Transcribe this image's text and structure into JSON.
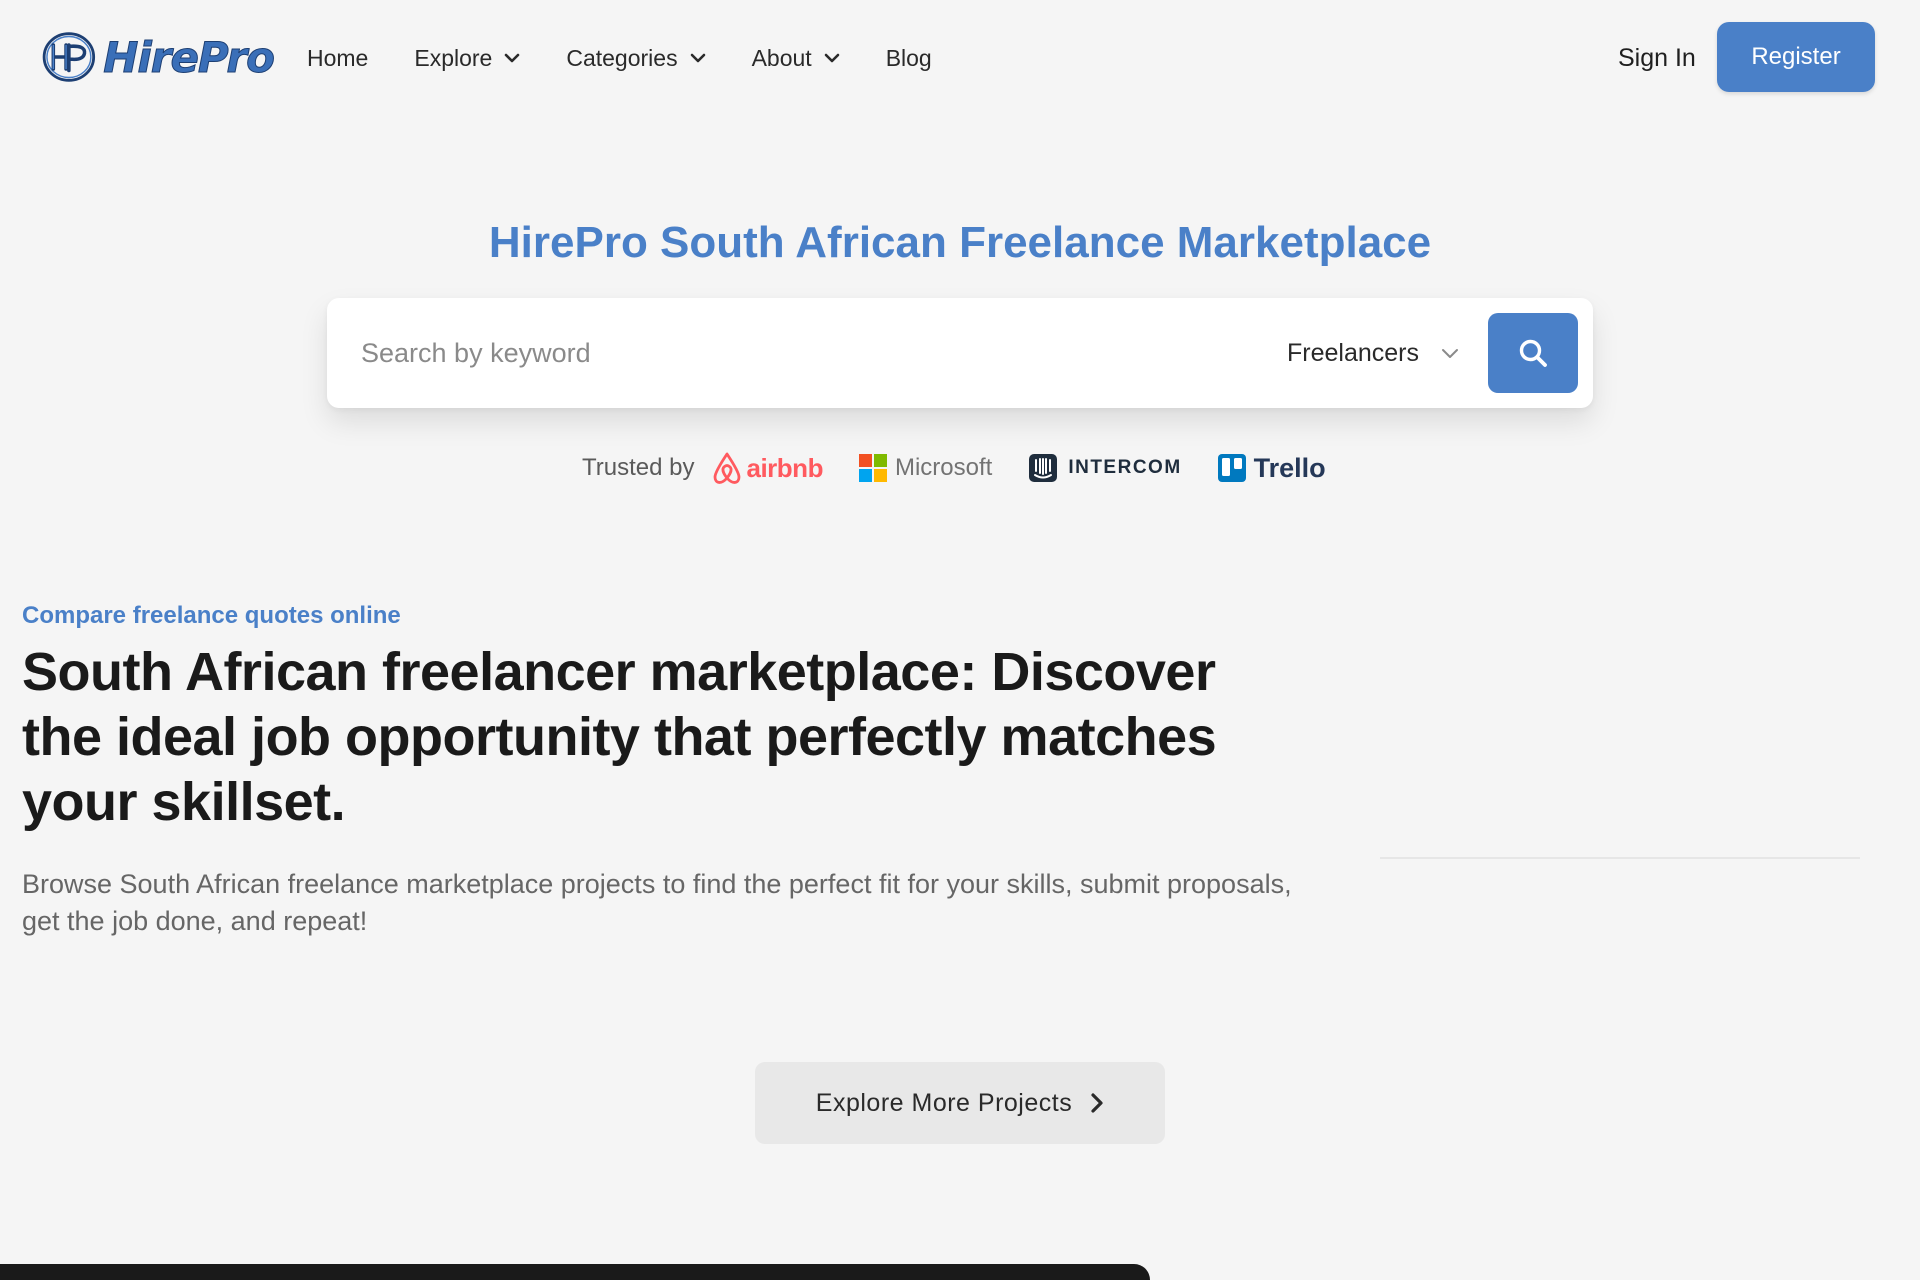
{
  "header": {
    "logo_text": "HirePro",
    "nav": [
      {
        "label": "Home",
        "has_dropdown": false
      },
      {
        "label": "Explore",
        "has_dropdown": true
      },
      {
        "label": "Categories",
        "has_dropdown": true
      },
      {
        "label": "About",
        "has_dropdown": true
      },
      {
        "label": "Blog",
        "has_dropdown": false
      }
    ],
    "sign_in_label": "Sign In",
    "register_label": "Register"
  },
  "hero": {
    "title": "HirePro South African Freelance Marketplace",
    "search": {
      "placeholder": "Search by keyword",
      "value": "",
      "selected_type": "Freelancers",
      "button_icon": "search-icon"
    },
    "trusted": {
      "label": "Trusted by",
      "brands": [
        "airbnb",
        "Microsoft",
        "INTERCOM",
        "Trello"
      ]
    }
  },
  "content": {
    "eyebrow": "Compare freelance quotes online",
    "headline": "South African freelancer marketplace: Discover the ideal job opportunity that perfectly matches your skillset.",
    "subtext": "Browse South African freelance marketplace projects to find the perfect fit for your skills, submit proposals, get the job done, and repeat!",
    "explore_button": "Explore More Projects"
  },
  "colors": {
    "accent": "#4a80c8",
    "background": "#f5f5f5",
    "airbnb": "#ff5a5f",
    "trello": "#0079bf"
  }
}
